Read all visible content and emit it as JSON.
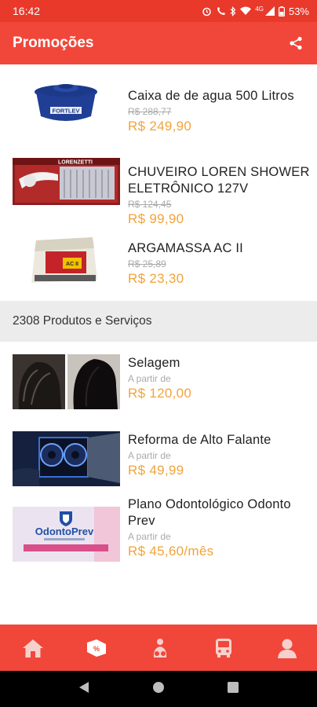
{
  "status": {
    "time": "16:42",
    "network": "4G",
    "battery": "53%"
  },
  "appbar": {
    "title": "Promoções",
    "share_icon": "share-icon"
  },
  "promotions": [
    {
      "name": "Caixa de de agua 500 Litros",
      "old_price": "R$ 288,77",
      "price": "R$ 249,90",
      "image_text": "FORTLEV"
    },
    {
      "name": "CHUVEIRO LOREN SHOWER ELETRÔNICO 127V",
      "old_price": "R$ 124,45",
      "price": "R$ 99,90",
      "image_text": "LORENZETTI"
    },
    {
      "name": "ARGAMASSA AC II",
      "old_price": "R$ 25,89",
      "price": "R$ 23,30",
      "image_text": "AC II"
    }
  ],
  "section": {
    "title": "2308 Produtos e Serviços"
  },
  "services": [
    {
      "name": "Selagem",
      "from_label": "A partir de",
      "price": "R$ 120,00"
    },
    {
      "name": "Reforma de Alto Falante",
      "from_label": "A partir de",
      "price": "R$ 49,99"
    },
    {
      "name": "Plano Odontológico Odonto Prev",
      "from_label": "A partir de",
      "price": "R$ 45,60/mês",
      "image_text": "OdontoPrev"
    }
  ],
  "tabbar": {
    "icons": [
      "home-icon",
      "promo-tag-icon",
      "services-icon",
      "bus-icon",
      "profile-icon"
    ]
  },
  "colors": {
    "statusbar": "#e8392b",
    "appbar": "#f0473a",
    "price": "#f2a33a"
  }
}
